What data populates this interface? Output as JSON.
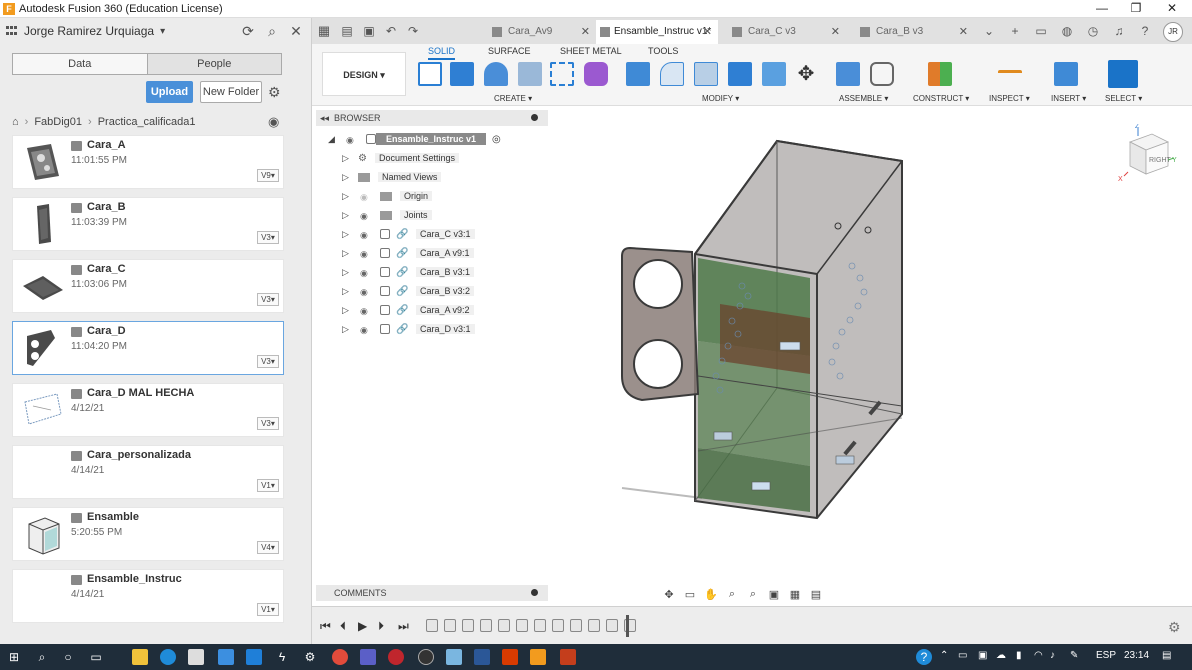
{
  "window": {
    "title": "Autodesk Fusion 360 (Education License)",
    "minimize": "—",
    "maximize": "❐",
    "close": "✕"
  },
  "data_panel": {
    "user_name": "Jorge Ramirez Urquiaga",
    "tabs": [
      {
        "label": "Data"
      },
      {
        "label": "People"
      }
    ],
    "upload_label": "Upload",
    "new_folder_label": "New Folder",
    "breadcrumb": [
      "FabDig01",
      "Practica_calificada1"
    ],
    "files": [
      {
        "name": "Cara_A",
        "date": "11:01:55 PM",
        "version": "V9▾"
      },
      {
        "name": "Cara_B",
        "date": "11:03:39 PM",
        "version": "V3▾"
      },
      {
        "name": "Cara_C",
        "date": "11:03:06 PM",
        "version": "V3▾"
      },
      {
        "name": "Cara_D",
        "date": "11:04:20 PM",
        "version": "V3▾"
      },
      {
        "name": "Cara_D MAL HECHA",
        "date": "4/12/21",
        "version": "V3▾"
      },
      {
        "name": "Cara_personalizada",
        "date": "4/14/21",
        "version": "V1▾"
      },
      {
        "name": "Ensamble",
        "date": "5:20:55 PM",
        "version": "V4▾"
      },
      {
        "name": "Ensamble_Instruc",
        "date": "4/14/21",
        "version": "V1▾"
      }
    ]
  },
  "doc_tabs": [
    {
      "label": "Cara_Av9",
      "close": "✕"
    },
    {
      "label": "Ensamble_Instruc v1*",
      "close": "✕"
    },
    {
      "label": "Cara_C v3",
      "close": "✕"
    },
    {
      "label": "Cara_B v3",
      "close": "✕"
    }
  ],
  "user_initials": "JR",
  "ribbon": {
    "workspace": "DESIGN ▾",
    "tabs": [
      "SOLID",
      "SURFACE",
      "SHEET METAL",
      "TOOLS"
    ],
    "groups": [
      "CREATE ▾",
      "MODIFY ▾",
      "ASSEMBLE ▾",
      "CONSTRUCT ▾",
      "INSPECT ▾",
      "INSERT ▾",
      "SELECT ▾"
    ]
  },
  "browser": {
    "title": "BROWSER",
    "root": "Ensamble_Instruc v1",
    "items": [
      {
        "label": "Document Settings",
        "kind": "settings"
      },
      {
        "label": "Named Views",
        "kind": "folder"
      },
      {
        "label": "Origin",
        "kind": "folder"
      },
      {
        "label": "Joints",
        "kind": "folder"
      },
      {
        "label": "Cara_C v3:1",
        "kind": "component"
      },
      {
        "label": "Cara_A v9:1",
        "kind": "component"
      },
      {
        "label": "Cara_B v3:1",
        "kind": "component"
      },
      {
        "label": "Cara_B v3:2",
        "kind": "component"
      },
      {
        "label": "Cara_A v9:2",
        "kind": "component"
      },
      {
        "label": "Cara_D v3:1",
        "kind": "component"
      }
    ]
  },
  "viewcube": {
    "face": "RIGHT",
    "axes": [
      "Z",
      "Y",
      "X"
    ]
  },
  "comments_label": "COMMENTS",
  "taskbar": {
    "language": "ESP",
    "time": "23:14"
  },
  "colors": {
    "accent": "#1a73c8",
    "upload": "#4a90d9",
    "taskbar": "#1f2d3a",
    "box_edge": "#3a3a3a",
    "green_panel": "#4f7a4a"
  }
}
